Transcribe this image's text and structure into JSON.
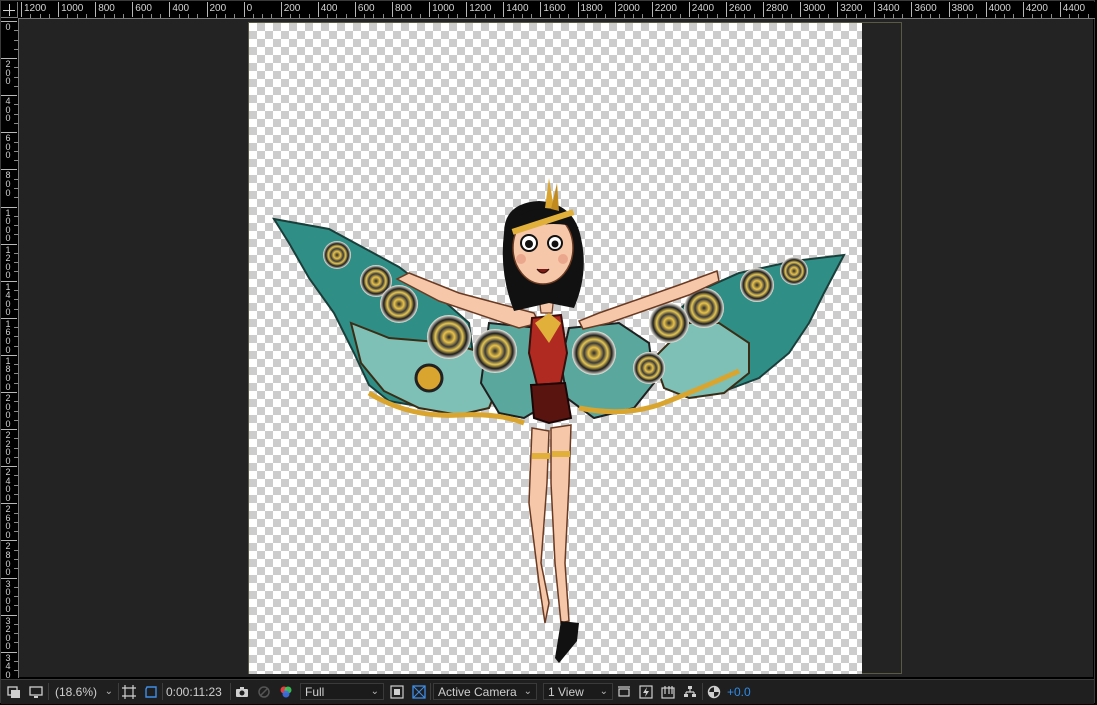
{
  "ruler": {
    "horizontal_labels": [
      "1200",
      "1000",
      "800",
      "600",
      "400",
      "200",
      "0",
      "200",
      "400",
      "600",
      "800",
      "1000",
      "1200",
      "1400",
      "1600",
      "1800",
      "2000",
      "2200",
      "2400",
      "2600",
      "2800",
      "3000",
      "3200",
      "3400",
      "3600",
      "3800",
      "4000",
      "4200",
      "4400"
    ],
    "vertical_labels": [
      "0",
      "200",
      "400",
      "600",
      "800",
      "1000",
      "1200",
      "1400",
      "1600",
      "1800",
      "2000",
      "2200",
      "2400",
      "2600",
      "2800",
      "3000",
      "3200",
      "3400"
    ]
  },
  "toolbar": {
    "always_preview_icon": "always-preview-icon",
    "monitor_icon": "monitor-icon",
    "magnification": "(18.6%)",
    "grid_icon": "grid-guides-icon",
    "mask_icon": "mask-visibility-icon",
    "timecode": "0:00:11:23",
    "snapshot_icon": "camera-icon",
    "show_snapshot_icon": "show-snapshot-icon",
    "channel_icon": "rgb-channel-icon",
    "resolution": "Full",
    "region_icon": "region-of-interest-icon",
    "transparency_icon": "transparency-grid-icon",
    "camera": "Active Camera",
    "views": "1 View",
    "toggle_pixel_icon": "pixel-aspect-icon",
    "fast_preview_icon": "fast-preview-icon",
    "timeline_icon": "timeline-icon",
    "flowchart_icon": "flowchart-icon",
    "reset_exposure_icon": "reset-exposure-icon",
    "exposure": "+0.0"
  },
  "colors": {
    "viewer_bg": "#232323",
    "accent_blue": "#2d8ceb",
    "wing_teal": "#2f8f86",
    "wing_gold": "#d9a52e"
  }
}
